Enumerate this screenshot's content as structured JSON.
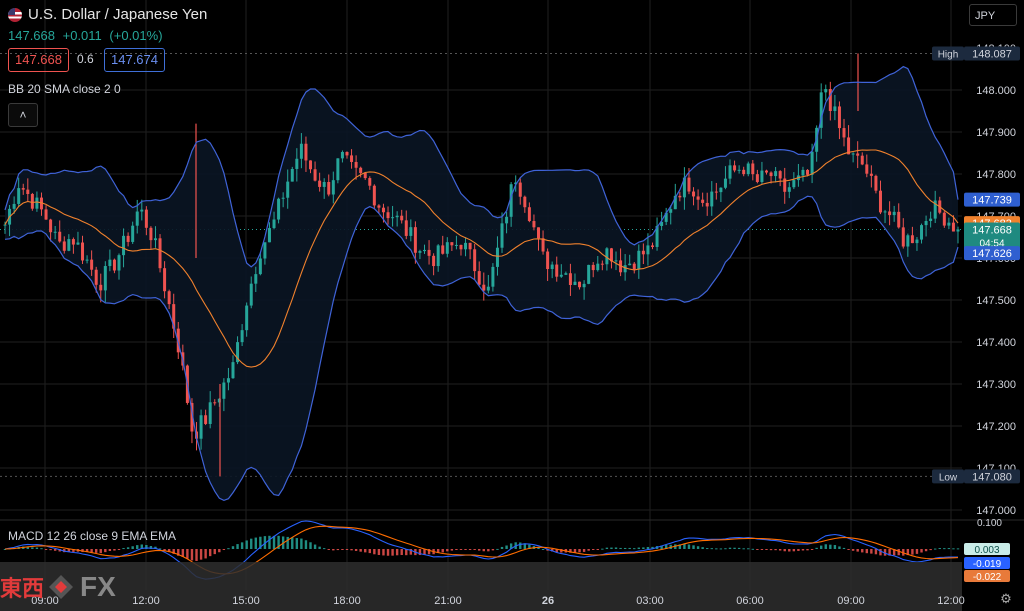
{
  "header": {
    "title": "U.S. Dollar / Japanese Yen",
    "last_price": "147.668",
    "change": "+0.011",
    "change_pct": "(+0.01%)",
    "sell_price": "147.668",
    "spread": "0.6",
    "buy_price": "147.674",
    "currency_button": "JPY"
  },
  "indicators": {
    "bb_label": "BB 20 SMA close 2 0",
    "collapse_icon": "chevron-up-icon",
    "macd_label": "MACD 12 26 close 9 EMA EMA"
  },
  "price_axis": {
    "ticks": [
      "148.000",
      "147.900",
      "147.800",
      "147.700",
      "147.600",
      "147.500",
      "147.400",
      "147.300",
      "147.200",
      "147.100",
      "147.000"
    ],
    "partial_top": "148.100",
    "high_label": "High",
    "high_value": "148.087",
    "low_label": "Low",
    "low_value": "147.080",
    "bb_upper": "147.739",
    "bb_mid": "147.683",
    "last": "147.668",
    "countdown": "04:54",
    "bb_lower": "147.626"
  },
  "macd_axis": {
    "top": "0.100",
    "hist": "0.003",
    "macd": "-0.019",
    "signal": "-0.022"
  },
  "time_axis": {
    "labels": [
      "09:00",
      "12:00",
      "15:00",
      "18:00",
      "21:00",
      "26",
      "03:00",
      "06:00",
      "09:00",
      "12:00"
    ]
  },
  "logo": {
    "kanji": "東西",
    "fx": "FX"
  },
  "colors": {
    "up": "#26a69a",
    "down": "#ef5350",
    "bb_band": "#3f63d8",
    "bb_basis": "#f0812d",
    "macd_line": "#2962ff",
    "signal_line": "#ff6d00",
    "bg": "#000000"
  },
  "chart_data": {
    "type": "candlestick",
    "ylim": [
      147.0,
      148.1
    ],
    "high": 148.087,
    "low": 147.08,
    "last": 147.668,
    "bb_upper_last": 147.739,
    "bb_basis_last": 147.683,
    "bb_lower_last": 147.626,
    "close_path": [
      {
        "t": 0,
        "v": 147.68
      },
      {
        "t": 1,
        "v": 147.78
      },
      {
        "t": 2,
        "v": 147.74
      },
      {
        "t": 3,
        "v": 147.7
      },
      {
        "t": 4,
        "v": 147.63
      },
      {
        "t": 5,
        "v": 147.65
      },
      {
        "t": 6,
        "v": 147.6
      },
      {
        "t": 7,
        "v": 147.54
      },
      {
        "t": 8,
        "v": 147.58
      },
      {
        "t": 9,
        "v": 147.64
      },
      {
        "t": 10,
        "v": 147.72
      },
      {
        "t": 11,
        "v": 147.65
      },
      {
        "t": 12,
        "v": 147.52
      },
      {
        "t": 13,
        "v": 147.38
      },
      {
        "t": 14,
        "v": 147.18
      },
      {
        "t": 15,
        "v": 147.22
      },
      {
        "t": 16,
        "v": 147.28
      },
      {
        "t": 17,
        "v": 147.34
      },
      {
        "t": 18,
        "v": 147.5
      },
      {
        "t": 19,
        "v": 147.62
      },
      {
        "t": 20,
        "v": 147.68
      },
      {
        "t": 21,
        "v": 147.78
      },
      {
        "t": 22,
        "v": 147.86
      },
      {
        "t": 23,
        "v": 147.8
      },
      {
        "t": 24,
        "v": 147.76
      },
      {
        "t": 25,
        "v": 147.84
      },
      {
        "t": 26,
        "v": 147.8
      },
      {
        "t": 27,
        "v": 147.78
      },
      {
        "t": 28,
        "v": 147.72
      },
      {
        "t": 29,
        "v": 147.7
      },
      {
        "t": 30,
        "v": 147.66
      },
      {
        "t": 31,
        "v": 147.62
      },
      {
        "t": 32,
        "v": 147.6
      },
      {
        "t": 33,
        "v": 147.62
      },
      {
        "t": 34,
        "v": 147.64
      },
      {
        "t": 35,
        "v": 147.58
      },
      {
        "t": 36,
        "v": 147.52
      },
      {
        "t": 37,
        "v": 147.66
      },
      {
        "t": 38,
        "v": 147.8
      },
      {
        "t": 39,
        "v": 147.72
      },
      {
        "t": 40,
        "v": 147.6
      },
      {
        "t": 41,
        "v": 147.58
      },
      {
        "t": 42,
        "v": 147.56
      },
      {
        "t": 43,
        "v": 147.54
      },
      {
        "t": 44,
        "v": 147.6
      },
      {
        "t": 45,
        "v": 147.62
      },
      {
        "t": 46,
        "v": 147.58
      },
      {
        "t": 47,
        "v": 147.6
      },
      {
        "t": 48,
        "v": 147.62
      },
      {
        "t": 49,
        "v": 147.68
      },
      {
        "t": 50,
        "v": 147.76
      },
      {
        "t": 51,
        "v": 147.78
      },
      {
        "t": 52,
        "v": 147.74
      },
      {
        "t": 53,
        "v": 147.76
      },
      {
        "t": 54,
        "v": 147.8
      },
      {
        "t": 55,
        "v": 147.82
      },
      {
        "t": 56,
        "v": 147.78
      },
      {
        "t": 57,
        "v": 147.8
      },
      {
        "t": 58,
        "v": 147.76
      },
      {
        "t": 59,
        "v": 147.78
      },
      {
        "t": 60,
        "v": 147.8
      },
      {
        "t": 61,
        "v": 148.02
      },
      {
        "t": 62,
        "v": 147.92
      },
      {
        "t": 63,
        "v": 147.84
      },
      {
        "t": 64,
        "v": 147.82
      },
      {
        "t": 65,
        "v": 147.74
      },
      {
        "t": 66,
        "v": 147.7
      },
      {
        "t": 67,
        "v": 147.64
      },
      {
        "t": 68,
        "v": 147.66
      },
      {
        "t": 69,
        "v": 147.72
      },
      {
        "t": 70,
        "v": 147.7
      },
      {
        "t": 71,
        "v": 147.668
      }
    ]
  }
}
